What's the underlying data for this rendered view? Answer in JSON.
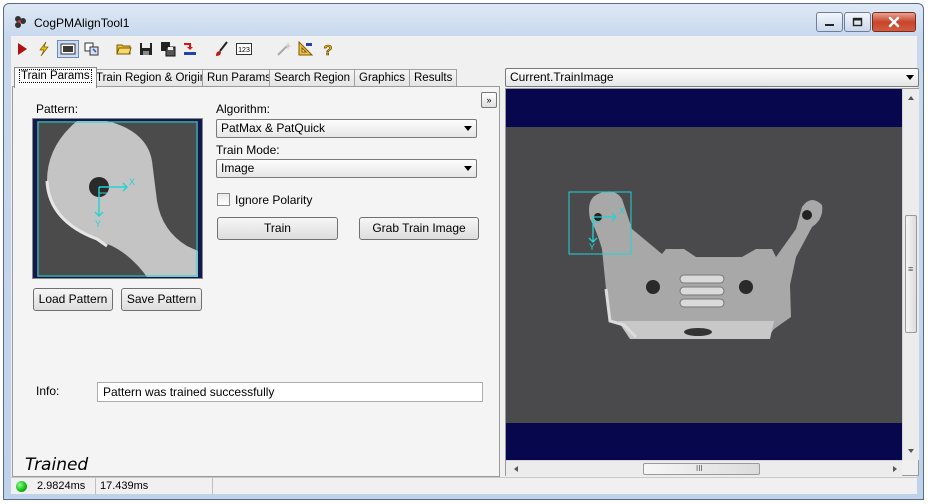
{
  "window": {
    "title": "CogPMAlignTool1"
  },
  "toolbar": {
    "icons": [
      "run-icon",
      "lightning-icon",
      "display-toggle-icon",
      "sync-icon",
      "open-folder-icon",
      "save-icon",
      "save-as-icon",
      "reset-icon",
      "brush-icon",
      "numeric-icon",
      "wand-disabled-icon",
      "ruler-icon",
      "help-icon"
    ]
  },
  "tabs": [
    "Train Params",
    "Train Region & Origin",
    "Run Params",
    "Search Region",
    "Graphics",
    "Results"
  ],
  "train_params": {
    "pattern_label": "Pattern:",
    "algorithm_label": "Algorithm:",
    "algorithm_value": "PatMax & PatQuick",
    "train_mode_label": "Train Mode:",
    "train_mode_value": "Image",
    "ignore_polarity_label": "Ignore Polarity",
    "ignore_polarity_checked": false,
    "train_button": "Train",
    "grab_button": "Grab Train Image",
    "load_button": "Load Pattern",
    "save_button": "Save Pattern",
    "info_label": "Info:",
    "info_value": "Pattern was trained successfully",
    "collapse_glyph": "»",
    "status_text": "Trained",
    "origin_x_label": "X",
    "origin_y_label": "Y"
  },
  "statusbar": {
    "led_color": "#0eb80e",
    "time1": "2.9824ms",
    "time2": "17.439ms"
  },
  "display": {
    "image_selector": "Current.TrainImage",
    "grip_glyph": "≡",
    "hscroll_grip": "III",
    "roi_x_label": "X",
    "roi_y_label": "Y"
  },
  "colors": {
    "accent_cyan": "#22d3d3",
    "canvas_bg": "#07074d"
  }
}
